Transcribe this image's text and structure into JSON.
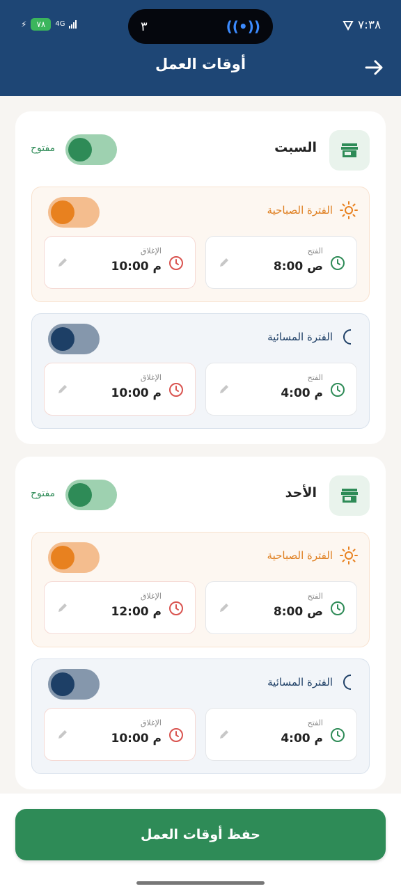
{
  "status_bar": {
    "time": "٧:٣٨",
    "battery": "٧٨",
    "network": "4G",
    "notch_count": "٣"
  },
  "header": {
    "title": "أوقات العمل"
  },
  "days": [
    {
      "name": "السبت",
      "status_label": "مفتوح",
      "open": true,
      "morning": {
        "title": "الفترة الصباحية",
        "enabled": true,
        "open_label": "الفتح",
        "open_time": "8:00 ص",
        "close_label": "الإغلاق",
        "close_time": "10:00 م"
      },
      "evening": {
        "title": "الفترة المسائية",
        "enabled": true,
        "open_label": "الفتح",
        "open_time": "4:00 م",
        "close_label": "الإغلاق",
        "close_time": "10:00 م"
      }
    },
    {
      "name": "الأحد",
      "status_label": "مفتوح",
      "open": true,
      "morning": {
        "title": "الفترة الصباحية",
        "enabled": true,
        "open_label": "الفتح",
        "open_time": "8:00 ص",
        "close_label": "الإغلاق",
        "close_time": "12:00 م"
      },
      "evening": {
        "title": "الفترة المسائية",
        "enabled": true,
        "open_label": "الفتح",
        "open_time": "4:00 م",
        "close_label": "الإغلاق",
        "close_time": "10:00 م"
      }
    }
  ],
  "footer": {
    "save_label": "حفظ أوقات العمل"
  },
  "colors": {
    "header_bg": "#1e4675",
    "primary_green": "#2e8b57",
    "morning_orange": "#e8811f",
    "evening_navy": "#1d3f66",
    "close_red": "#d9534f"
  }
}
